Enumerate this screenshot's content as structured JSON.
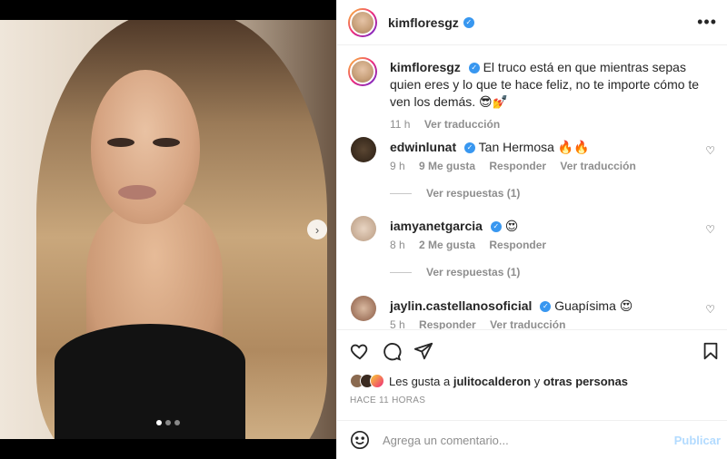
{
  "post": {
    "username": "kimfloresgz",
    "caption": "El truco está en que mientras sepas quien eres y lo que te hace feliz, no te importe cómo te ven los demás. 😎💅",
    "caption_time": "11 h",
    "translate_label": "Ver traducción",
    "more_label": "•••",
    "carousel_next": "›"
  },
  "comments": [
    {
      "username": "edwinlunat",
      "text": "Tan Hermosa 🔥🔥",
      "time": "9 h",
      "likes": "9 Me gusta",
      "reply_label": "Responder",
      "translate_label": "Ver traducción",
      "replies_label": "Ver respuestas (1)"
    },
    {
      "username": "iamyanetgarcia",
      "text": "😍",
      "time": "8 h",
      "likes": "2 Me gusta",
      "reply_label": "Responder",
      "replies_label": "Ver respuestas (1)"
    },
    {
      "username": "jaylin.castellanosoficial",
      "text": "Guapísima 😍",
      "time": "5 h",
      "reply_label": "Responder",
      "translate_label": "Ver traducción"
    }
  ],
  "likes": {
    "prefix": "Les gusta a",
    "user": "julitocalderon",
    "connector": "y",
    "others": "otras personas"
  },
  "time_ago": "HACE 11 HORAS",
  "comment_box": {
    "placeholder": "Agrega un comentario...",
    "publish_label": "Publicar"
  },
  "colors": {
    "verified": "#3897f0",
    "publish_disabled": "#b3dbff"
  },
  "carousel": {
    "slides": 3,
    "active": 1
  }
}
